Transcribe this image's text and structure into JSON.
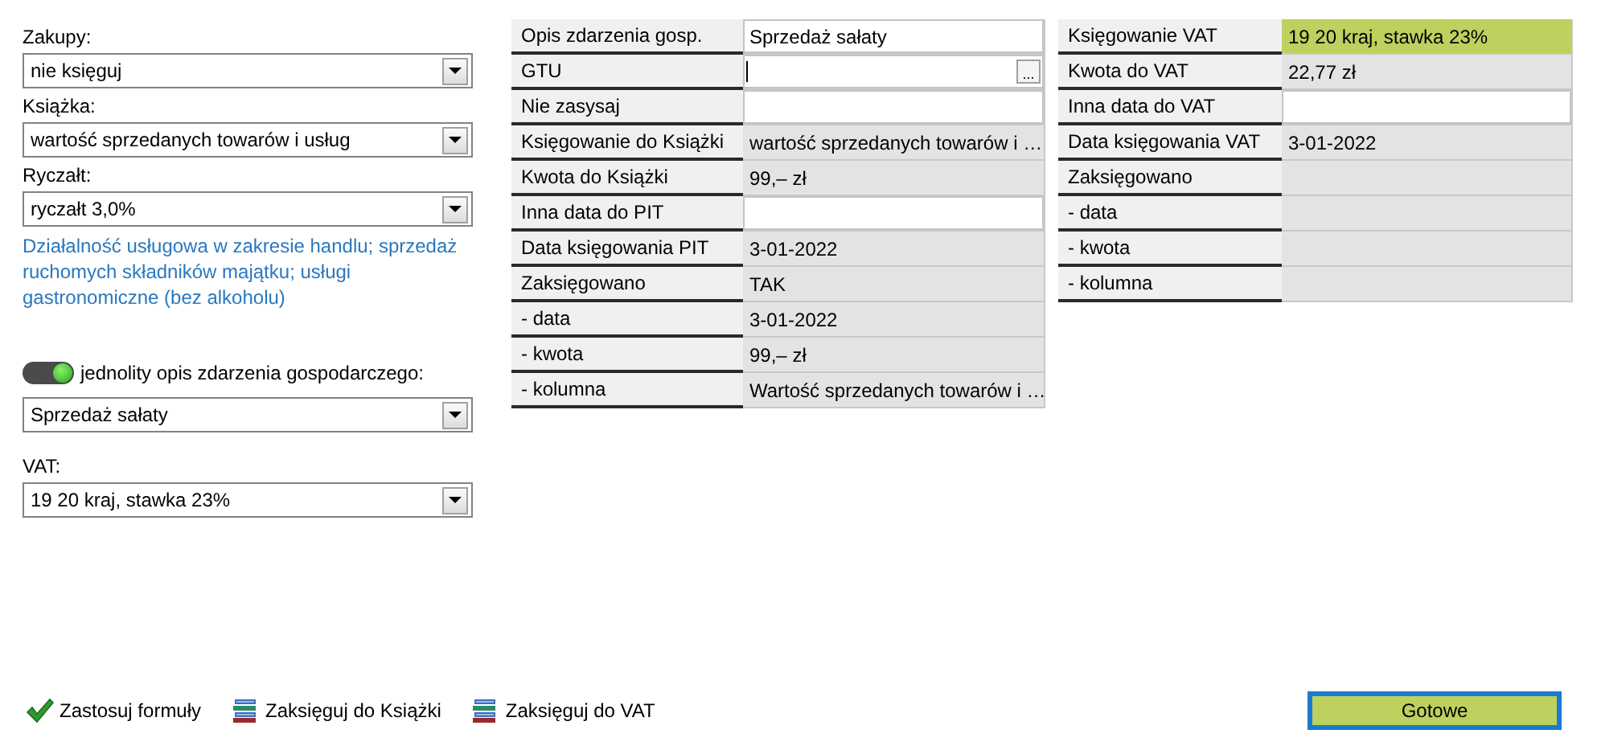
{
  "left_panel": {
    "fields": [
      {
        "label": "Zakupy:",
        "value": "nie księguj"
      },
      {
        "label": "Książka:",
        "value": "wartość sprzedanych towarów i usług"
      },
      {
        "label": "Ryczałt:",
        "value": "ryczałt 3,0%",
        "note": "Działalność usługowa w zakresie handlu; sprzedaż ruchomych składników majątku; usługi gastronomiczne (bez alkoholu)"
      }
    ],
    "toggle": {
      "label": "jednolity opis zdarzenia gospodarczego:",
      "on": true,
      "value": "Sprzedaż sałaty"
    },
    "vat": {
      "label": "VAT:",
      "value": "19 20 kraj, stawka 23%"
    }
  },
  "book_grid": {
    "rows": [
      {
        "label": "Opis zdarzenia gosp.",
        "value": "Sprzedaż sałaty",
        "kind": "text",
        "editable": true
      },
      {
        "label": "GTU",
        "value_button": "...",
        "kind": "input",
        "editable": true
      },
      {
        "label": "Nie zasysaj",
        "kind": "text",
        "editable": true
      },
      {
        "label": "Księgowanie do Książki",
        "value": "wartość sprzedanych towarów i …",
        "kind": "text",
        "editable": false
      },
      {
        "label": "Kwota do Książki",
        "value": "99,– zł",
        "kind": "text",
        "editable": false
      },
      {
        "label": "Inna data do PIT",
        "kind": "text",
        "editable": true
      },
      {
        "label": "Data księgowania PIT",
        "value": "3-01-2022",
        "kind": "text",
        "editable": false
      },
      {
        "label": "Zaksięgowano",
        "value": "TAK",
        "kind": "text",
        "editable": false
      },
      {
        "label": "- data",
        "value": "3-01-2022",
        "kind": "text",
        "editable": false
      },
      {
        "label": "- kwota",
        "value": "99,– zł",
        "kind": "text",
        "editable": false
      },
      {
        "label": "- kolumna",
        "value": "Wartość sprzedanych towarów i …",
        "kind": "text",
        "editable": false
      }
    ]
  },
  "vat_grid": {
    "rows": [
      {
        "label": "Księgowanie VAT",
        "value": "19 20 kraj, stawka 23%",
        "kind": "text",
        "editable": false,
        "highlighted": true
      },
      {
        "label": "Kwota do VAT",
        "value": "22,77 zł",
        "kind": "text",
        "editable": false,
        "highlighted": false
      },
      {
        "label": "Inna data do VAT",
        "kind": "text",
        "editable": true,
        "highlighted": false
      },
      {
        "label": "Data księgowania VAT",
        "value": "3-01-2022",
        "kind": "text",
        "editable": false,
        "highlighted": false
      },
      {
        "label": "Zaksięgowano",
        "kind": "text",
        "editable": false,
        "highlighted": false
      },
      {
        "label": "- data",
        "kind": "text",
        "editable": false,
        "highlighted": false
      },
      {
        "label": "- kwota",
        "kind": "text",
        "editable": false,
        "highlighted": false
      },
      {
        "label": "- kolumna",
        "kind": "text",
        "editable": false,
        "highlighted": false
      }
    ]
  },
  "toolbar": {
    "actions": [
      {
        "label": "Zastosuj formuły",
        "kind": "check"
      },
      {
        "label": "Zaksięguj do Książki",
        "kind": "books"
      },
      {
        "label": "Zaksięguj do VAT",
        "kind": "books"
      }
    ],
    "done_button": "Gotowe"
  }
}
